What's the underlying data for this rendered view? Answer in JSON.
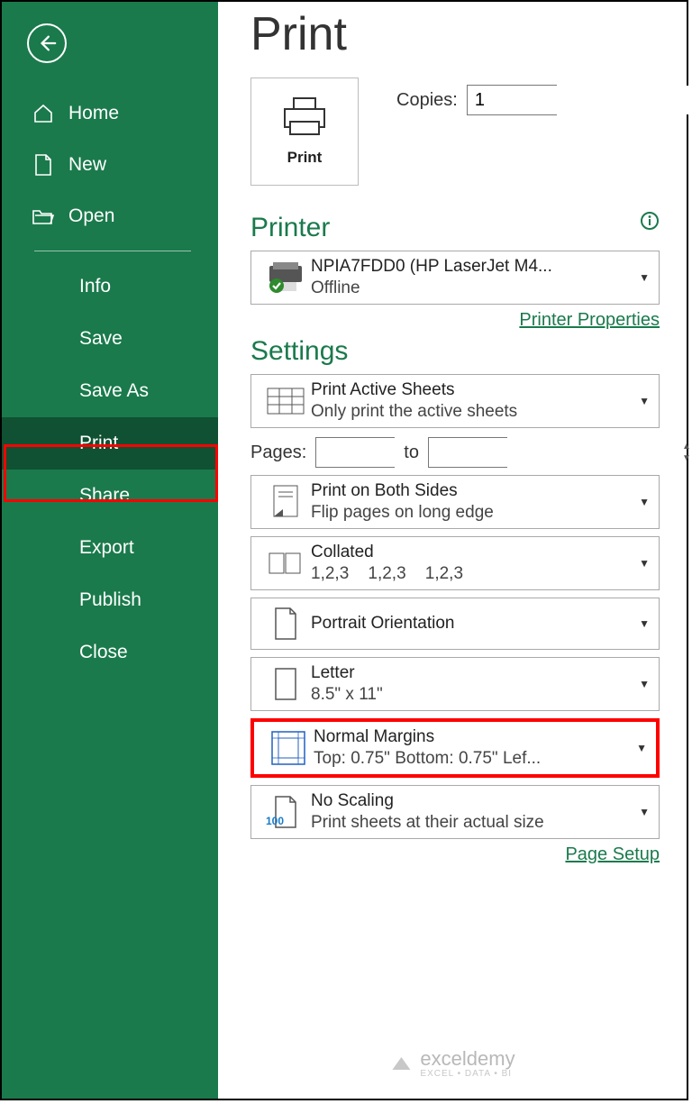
{
  "sidebar": {
    "top": [
      {
        "label": "Home"
      },
      {
        "label": "New"
      },
      {
        "label": "Open"
      }
    ],
    "sub": [
      {
        "label": "Info"
      },
      {
        "label": "Save"
      },
      {
        "label": "Save As"
      },
      {
        "label": "Print"
      },
      {
        "label": "Share"
      },
      {
        "label": "Export"
      },
      {
        "label": "Publish"
      },
      {
        "label": "Close"
      }
    ]
  },
  "main": {
    "title": "Print",
    "print_button": "Print",
    "copies_label": "Copies:",
    "copies_value": "1",
    "printer_heading": "Printer",
    "printer": {
      "name": "NPIA7FDD0 (HP LaserJet M4...",
      "status": "Offline"
    },
    "printer_props_link": "Printer Properties",
    "settings_heading": "Settings",
    "settings": {
      "print_what": {
        "line1": "Print Active Sheets",
        "line2": "Only print the active sheets"
      },
      "pages_label": "Pages:",
      "pages_to": "to",
      "pages_from": "",
      "pages_to_val": "",
      "sides": {
        "line1": "Print on Both Sides",
        "line2": "Flip pages on long edge"
      },
      "collated": {
        "line1": "Collated",
        "line2": "1,2,3    1,2,3    1,2,3"
      },
      "orientation": {
        "line1": "Portrait Orientation"
      },
      "paper": {
        "line1": "Letter",
        "line2": "8.5\" x 11\""
      },
      "margins": {
        "line1": "Normal Margins",
        "line2": "Top: 0.75\" Bottom: 0.75\" Lef..."
      },
      "scaling": {
        "line1": "No Scaling",
        "line2": "Print sheets at their actual size",
        "badge": "100"
      }
    },
    "page_setup_link": "Page Setup"
  },
  "watermark": {
    "brand": "exceldemy",
    "tag": "EXCEL • DATA • BI"
  }
}
